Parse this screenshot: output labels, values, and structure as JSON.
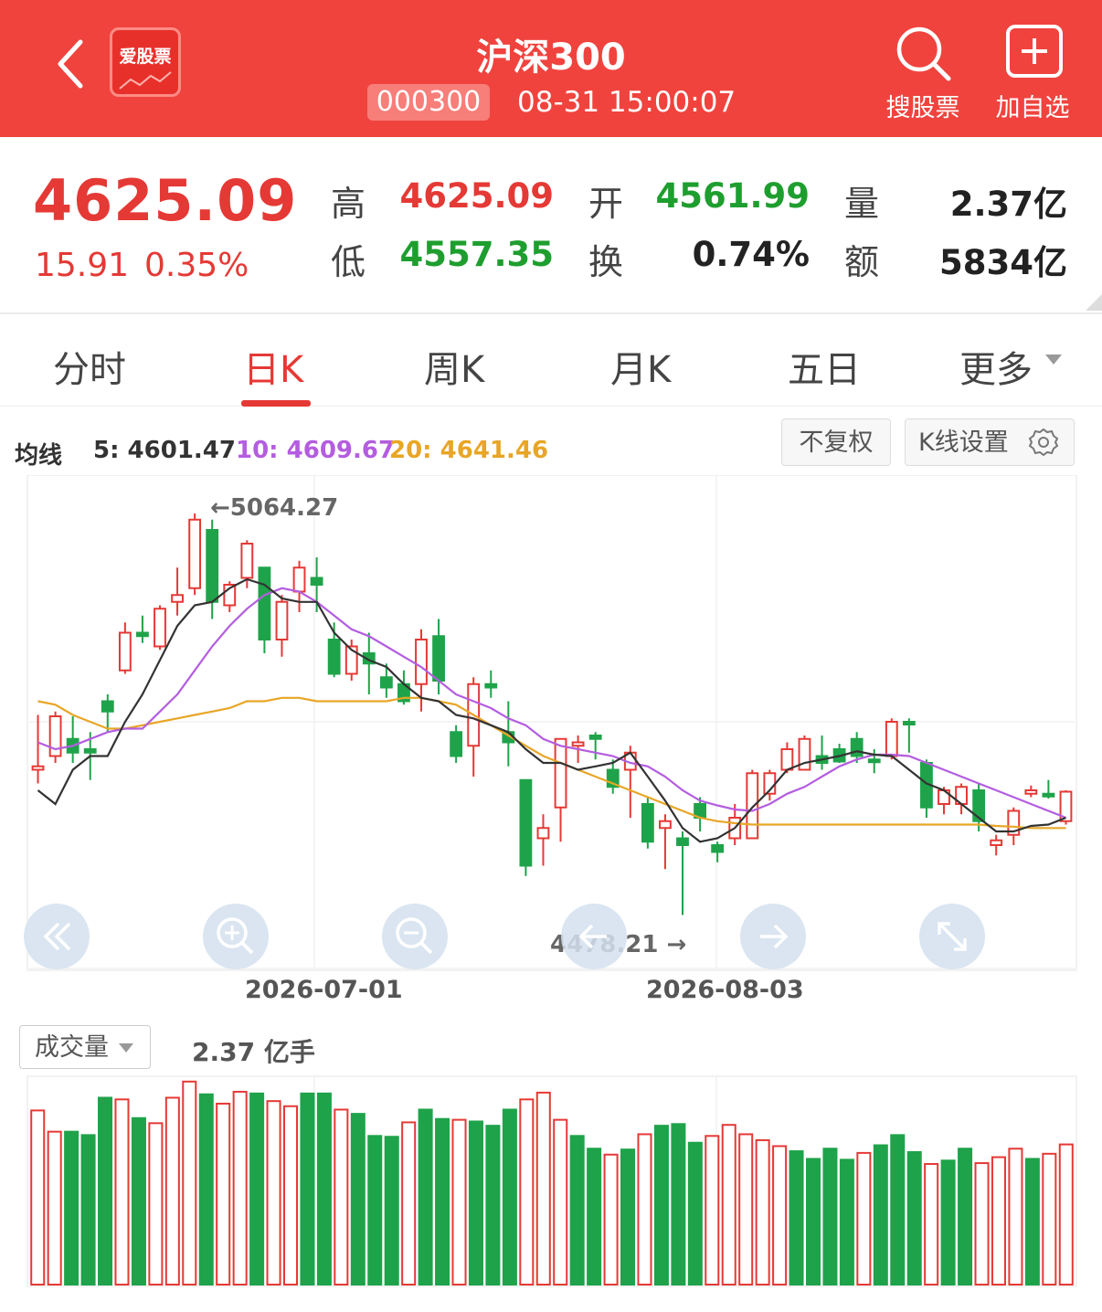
{
  "header": {
    "logo_text": "爱股票",
    "title": "沪深300",
    "code": "000300",
    "time": "08-31 15:00:07",
    "search_label": "搜股票",
    "add_label": "加自选"
  },
  "quote": {
    "price": "4625.09",
    "change": "15.91",
    "change_pct": "0.35%",
    "high_label": "高",
    "high": "4625.09",
    "low_label": "低",
    "low": "4557.35",
    "open_label": "开",
    "open": "4561.99",
    "turnover_label": "换",
    "turnover": "0.74%",
    "volume_label": "量",
    "volume": "2.37亿",
    "amount_label": "额",
    "amount": "5834亿"
  },
  "tabs": [
    "分时",
    "日K",
    "周K",
    "月K",
    "五日",
    "更多"
  ],
  "active_tab": "日K",
  "ma": {
    "label": "均线",
    "ma5": "5: 4601.47",
    "ma10": "10: 4609.67",
    "ma20": "20: 4641.46"
  },
  "buttons": {
    "adjust": "不复权",
    "kline_settings": "K线设置"
  },
  "nav_icons": [
    "rewind-icon",
    "zoom-in-icon",
    "zoom-out-icon",
    "prev-icon",
    "next-icon",
    "fullscreen-icon"
  ],
  "colors": {
    "up": "#e53935",
    "down": "#1fa34a",
    "ma5": "#333333",
    "ma10": "#b45de0",
    "ma20": "#e8a626",
    "header": "#f0433e"
  },
  "chart_data": {
    "type": "candlestick",
    "y_range": [
      4400,
      5120
    ],
    "max_label": "←5064.27",
    "min_label": "4478.21 →",
    "x_labels": [
      "2026-07-01",
      "2026-08-03"
    ],
    "candles": [
      {
        "o": 4690,
        "h": 4770,
        "l": 4670,
        "c": 4695,
        "up": true
      },
      {
        "o": 4710,
        "h": 4775,
        "l": 4700,
        "c": 4768,
        "up": true
      },
      {
        "o": 4735,
        "h": 4768,
        "l": 4700,
        "c": 4715,
        "up": false
      },
      {
        "o": 4720,
        "h": 4745,
        "l": 4675,
        "c": 4715,
        "up": false
      },
      {
        "o": 4790,
        "h": 4800,
        "l": 4745,
        "c": 4775,
        "up": false
      },
      {
        "o": 4835,
        "h": 4905,
        "l": 4830,
        "c": 4890,
        "up": true
      },
      {
        "o": 4890,
        "h": 4915,
        "l": 4875,
        "c": 4885,
        "up": false
      },
      {
        "o": 4870,
        "h": 4930,
        "l": 4865,
        "c": 4925,
        "up": true
      },
      {
        "o": 4935,
        "h": 4985,
        "l": 4915,
        "c": 4945,
        "up": true
      },
      {
        "o": 4955,
        "h": 5064,
        "l": 4945,
        "c": 5055,
        "up": true
      },
      {
        "o": 5040,
        "h": 5055,
        "l": 4910,
        "c": 4935,
        "up": false
      },
      {
        "o": 4930,
        "h": 4965,
        "l": 4920,
        "c": 4960,
        "up": true
      },
      {
        "o": 4970,
        "h": 5025,
        "l": 4955,
        "c": 5020,
        "up": true
      },
      {
        "o": 4985,
        "h": 4985,
        "l": 4860,
        "c": 4880,
        "up": false
      },
      {
        "o": 4880,
        "h": 4945,
        "l": 4855,
        "c": 4935,
        "up": true
      },
      {
        "o": 4950,
        "h": 4995,
        "l": 4920,
        "c": 4985,
        "up": true
      },
      {
        "o": 4970,
        "h": 5000,
        "l": 4920,
        "c": 4960,
        "up": false
      },
      {
        "o": 4880,
        "h": 4905,
        "l": 4825,
        "c": 4830,
        "up": false
      },
      {
        "o": 4830,
        "h": 4880,
        "l": 4820,
        "c": 4870,
        "up": true
      },
      {
        "o": 4860,
        "h": 4890,
        "l": 4800,
        "c": 4845,
        "up": false
      },
      {
        "o": 4825,
        "h": 4845,
        "l": 4795,
        "c": 4810,
        "up": false
      },
      {
        "o": 4815,
        "h": 4835,
        "l": 4785,
        "c": 4790,
        "up": false
      },
      {
        "o": 4815,
        "h": 4895,
        "l": 4775,
        "c": 4880,
        "up": true
      },
      {
        "o": 4885,
        "h": 4910,
        "l": 4800,
        "c": 4820,
        "up": false
      },
      {
        "o": 4745,
        "h": 4755,
        "l": 4700,
        "c": 4710,
        "up": false
      },
      {
        "o": 4725,
        "h": 4825,
        "l": 4680,
        "c": 4815,
        "up": true
      },
      {
        "o": 4815,
        "h": 4835,
        "l": 4795,
        "c": 4810,
        "up": false
      },
      {
        "o": 4745,
        "h": 4790,
        "l": 4695,
        "c": 4730,
        "up": false
      },
      {
        "o": 4675,
        "h": 4675,
        "l": 4535,
        "c": 4550,
        "up": false
      },
      {
        "o": 4590,
        "h": 4625,
        "l": 4550,
        "c": 4605,
        "up": true
      },
      {
        "o": 4635,
        "h": 4735,
        "l": 4585,
        "c": 4735,
        "up": true
      },
      {
        "o": 4730,
        "h": 4740,
        "l": 4700,
        "c": 4725,
        "up": true
      },
      {
        "o": 4740,
        "h": 4745,
        "l": 4705,
        "c": 4735,
        "up": false
      },
      {
        "o": 4690,
        "h": 4705,
        "l": 4655,
        "c": 4665,
        "up": false
      },
      {
        "o": 4690,
        "h": 4725,
        "l": 4620,
        "c": 4715,
        "up": true
      },
      {
        "o": 4640,
        "h": 4650,
        "l": 4575,
        "c": 4585,
        "up": false
      },
      {
        "o": 4615,
        "h": 4625,
        "l": 4545,
        "c": 4605,
        "up": true
      },
      {
        "o": 4590,
        "h": 4600,
        "l": 4478,
        "c": 4580,
        "up": false
      },
      {
        "o": 4640,
        "h": 4650,
        "l": 4600,
        "c": 4620,
        "up": false
      },
      {
        "o": 4580,
        "h": 4585,
        "l": 4555,
        "c": 4570,
        "up": false
      },
      {
        "o": 4590,
        "h": 4640,
        "l": 4580,
        "c": 4620,
        "up": true
      },
      {
        "o": 4590,
        "h": 4690,
        "l": 4590,
        "c": 4685,
        "up": true
      },
      {
        "o": 4655,
        "h": 4690,
        "l": 4645,
        "c": 4685,
        "up": true
      },
      {
        "o": 4690,
        "h": 4730,
        "l": 4685,
        "c": 4720,
        "up": true
      },
      {
        "o": 4690,
        "h": 4740,
        "l": 4690,
        "c": 4735,
        "up": true
      },
      {
        "o": 4710,
        "h": 4740,
        "l": 4690,
        "c": 4700,
        "up": false
      },
      {
        "o": 4720,
        "h": 4728,
        "l": 4700,
        "c": 4702,
        "up": false
      },
      {
        "o": 4735,
        "h": 4745,
        "l": 4700,
        "c": 4710,
        "up": false
      },
      {
        "o": 4705,
        "h": 4720,
        "l": 4685,
        "c": 4702,
        "up": false
      },
      {
        "o": 4710,
        "h": 4765,
        "l": 4705,
        "c": 4760,
        "up": true
      },
      {
        "o": 4760,
        "h": 4765,
        "l": 4715,
        "c": 4757,
        "up": false
      },
      {
        "o": 4700,
        "h": 4705,
        "l": 4620,
        "c": 4635,
        "up": false
      },
      {
        "o": 4640,
        "h": 4665,
        "l": 4625,
        "c": 4660,
        "up": true
      },
      {
        "o": 4640,
        "h": 4670,
        "l": 4625,
        "c": 4665,
        "up": true
      },
      {
        "o": 4660,
        "h": 4670,
        "l": 4600,
        "c": 4615,
        "up": false
      },
      {
        "o": 4580,
        "h": 4595,
        "l": 4565,
        "c": 4587,
        "up": true
      },
      {
        "o": 4595,
        "h": 4635,
        "l": 4580,
        "c": 4630,
        "up": true
      },
      {
        "o": 4655,
        "h": 4667,
        "l": 4650,
        "c": 4660,
        "up": true
      },
      {
        "o": 4655,
        "h": 4675,
        "l": 4648,
        "c": 4652,
        "up": false
      },
      {
        "o": 4615,
        "h": 4660,
        "l": 4610,
        "c": 4658,
        "up": true
      }
    ],
    "ma5": [
      4660,
      4640,
      4690,
      4710,
      4710,
      4760,
      4800,
      4850,
      4900,
      4930,
      4935,
      4955,
      4968,
      4960,
      4940,
      4935,
      4935,
      4890,
      4865,
      4850,
      4840,
      4815,
      4795,
      4790,
      4770,
      4765,
      4755,
      4745,
      4720,
      4700,
      4700,
      4690,
      4695,
      4700,
      4715,
      4680,
      4645,
      4605,
      4585,
      4590,
      4605,
      4635,
      4660,
      4690,
      4700,
      4705,
      4710,
      4717,
      4712,
      4710,
      4690,
      4670,
      4660,
      4640,
      4620,
      4600,
      4600,
      4608,
      4610,
      4620
    ],
    "ma10": [
      4730,
      4720,
      4725,
      4735,
      4745,
      4750,
      4750,
      4775,
      4800,
      4835,
      4870,
      4900,
      4925,
      4945,
      4955,
      4950,
      4935,
      4915,
      4895,
      4885,
      4870,
      4855,
      4840,
      4820,
      4800,
      4790,
      4780,
      4765,
      4755,
      4735,
      4725,
      4720,
      4715,
      4710,
      4700,
      4695,
      4680,
      4660,
      4645,
      4638,
      4632,
      4630,
      4640,
      4655,
      4665,
      4680,
      4695,
      4705,
      4712,
      4712,
      4710,
      4700,
      4690,
      4680,
      4670,
      4660,
      4650,
      4640,
      4630,
      4620
    ],
    "ma20": [
      4790,
      4785,
      4770,
      4760,
      4750,
      4750,
      4755,
      4760,
      4765,
      4770,
      4775,
      4780,
      4790,
      4790,
      4795,
      4795,
      4790,
      4790,
      4790,
      4790,
      4790,
      4795,
      4795,
      4790,
      4785,
      4770,
      4755,
      4740,
      4725,
      4710,
      4700,
      4690,
      4680,
      4670,
      4660,
      4650,
      4640,
      4630,
      4620,
      4615,
      4612,
      4610,
      4610,
      4610,
      4610,
      4610,
      4610,
      4610,
      4610,
      4610,
      4610,
      4610,
      4610,
      4610,
      4610,
      4608,
      4607,
      4605,
      4605,
      4605
    ]
  },
  "volume": {
    "label": "成交量",
    "value": "2.37 亿手",
    "bars": [
      {
        "v": 2.05,
        "up": true
      },
      {
        "v": 1.8,
        "up": true
      },
      {
        "v": 1.8,
        "up": false
      },
      {
        "v": 1.76,
        "up": false
      },
      {
        "v": 2.2,
        "up": false
      },
      {
        "v": 2.18,
        "up": true
      },
      {
        "v": 1.96,
        "up": false
      },
      {
        "v": 1.9,
        "up": true
      },
      {
        "v": 2.2,
        "up": true
      },
      {
        "v": 2.39,
        "up": true
      },
      {
        "v": 2.24,
        "up": false
      },
      {
        "v": 2.13,
        "up": true
      },
      {
        "v": 2.27,
        "up": true
      },
      {
        "v": 2.25,
        "up": false
      },
      {
        "v": 2.16,
        "up": true
      },
      {
        "v": 2.1,
        "up": true
      },
      {
        "v": 2.25,
        "up": false
      },
      {
        "v": 2.25,
        "up": false
      },
      {
        "v": 2.06,
        "up": true
      },
      {
        "v": 2.01,
        "up": false
      },
      {
        "v": 1.75,
        "up": false
      },
      {
        "v": 1.74,
        "up": false
      },
      {
        "v": 1.91,
        "up": true
      },
      {
        "v": 2.06,
        "up": false
      },
      {
        "v": 1.95,
        "up": false
      },
      {
        "v": 1.94,
        "up": true
      },
      {
        "v": 1.92,
        "up": false
      },
      {
        "v": 1.87,
        "up": false
      },
      {
        "v": 2.06,
        "up": false
      },
      {
        "v": 2.18,
        "up": true
      },
      {
        "v": 2.26,
        "up": true
      },
      {
        "v": 1.94,
        "up": true
      },
      {
        "v": 1.75,
        "up": false
      },
      {
        "v": 1.6,
        "up": false
      },
      {
        "v": 1.53,
        "up": true
      },
      {
        "v": 1.59,
        "up": false
      },
      {
        "v": 1.77,
        "up": true
      },
      {
        "v": 1.87,
        "up": false
      },
      {
        "v": 1.89,
        "up": false
      },
      {
        "v": 1.67,
        "up": false
      },
      {
        "v": 1.75,
        "up": true
      },
      {
        "v": 1.88,
        "up": true
      },
      {
        "v": 1.77,
        "up": true
      },
      {
        "v": 1.7,
        "up": true
      },
      {
        "v": 1.63,
        "up": true
      },
      {
        "v": 1.57,
        "up": false
      },
      {
        "v": 1.48,
        "up": false
      },
      {
        "v": 1.6,
        "up": false
      },
      {
        "v": 1.47,
        "up": false
      },
      {
        "v": 1.55,
        "up": true
      },
      {
        "v": 1.64,
        "up": false
      },
      {
        "v": 1.76,
        "up": false
      },
      {
        "v": 1.56,
        "up": false
      },
      {
        "v": 1.42,
        "up": true
      },
      {
        "v": 1.46,
        "up": false
      },
      {
        "v": 1.6,
        "up": false
      },
      {
        "v": 1.43,
        "up": true
      },
      {
        "v": 1.5,
        "up": true
      },
      {
        "v": 1.6,
        "up": true
      },
      {
        "v": 1.48,
        "up": false
      },
      {
        "v": 1.54,
        "up": true
      },
      {
        "v": 1.65,
        "up": true
      }
    ],
    "v_range": [
      0,
      2.42
    ]
  }
}
